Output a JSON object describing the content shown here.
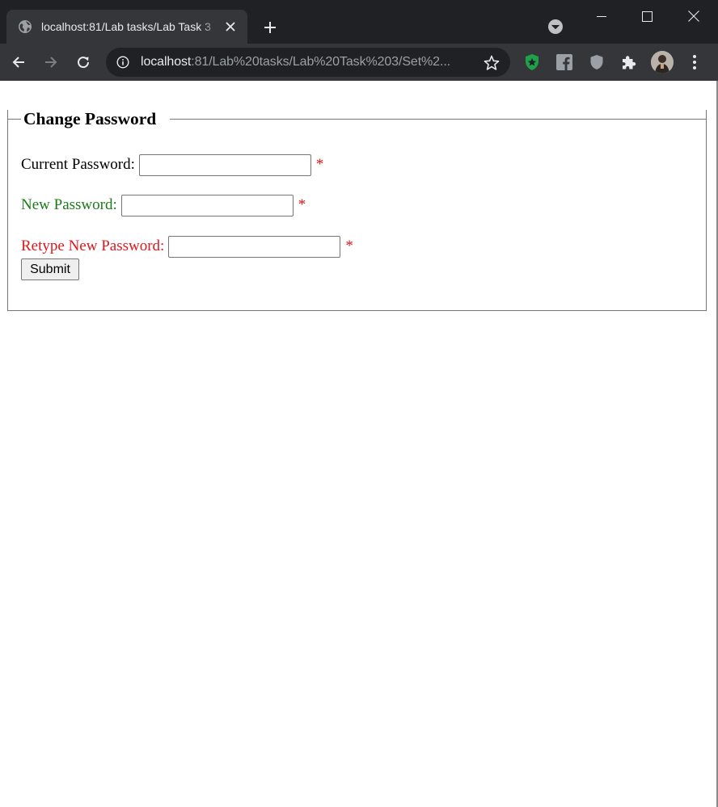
{
  "browser": {
    "tab_title": "localhost:81/Lab tasks/Lab Task 3",
    "url_host": "localhost",
    "url_rest": ":81/Lab%20tasks/Lab%20Task%203/Set%2..."
  },
  "form": {
    "legend": "Change Password",
    "fields": [
      {
        "label": "Current Password:",
        "value": "",
        "required_mark": "*",
        "label_color": "#000000"
      },
      {
        "label": "New Password:",
        "value": "",
        "required_mark": "*",
        "label_color": "#1a7a1a"
      },
      {
        "label": "Retype New Password:",
        "value": "",
        "required_mark": "*",
        "label_color": "#e0181c"
      }
    ],
    "submit_label": "Submit"
  },
  "colors": {
    "chrome_dark": "#202124",
    "chrome_toolbar": "#35363a",
    "required_red": "#e0181c",
    "adblock_green": "#1fa14a"
  },
  "icons": {
    "favicon": "globe-icon",
    "extensions": [
      "adblock-icon",
      "facebook-icon",
      "shield-icon",
      "puzzle-icon"
    ]
  }
}
